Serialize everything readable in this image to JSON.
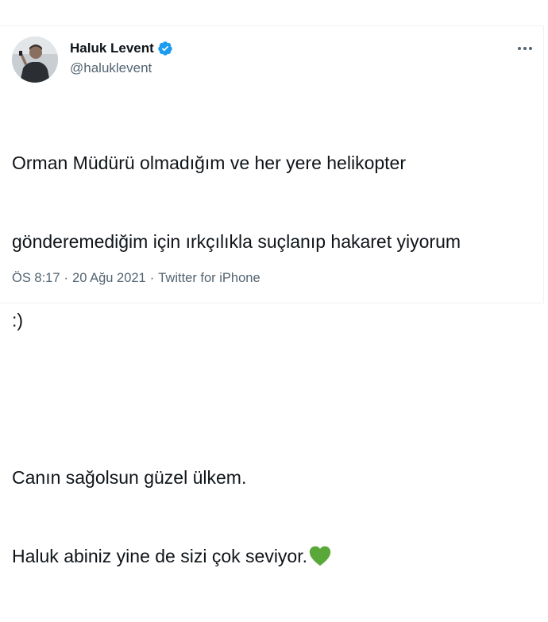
{
  "tweet": {
    "author": {
      "display_name": "Haluk Levent",
      "handle": "@haluklevent",
      "verified_icon": "verified-badge-icon",
      "avatar_icon": "profile-photo"
    },
    "more_icon": "more-options-icon",
    "text_lines": [
      "Orman Müdürü olmadığım ve her yere helikopter",
      "gönderemediğim için ırkçılıkla suçlanıp hakaret yiyorum",
      ":)",
      "",
      "Canın sağolsun güzel ülkem.",
      "Haluk abiniz yine de sizi çok seviyor."
    ],
    "emoji_icon": "green-heart-icon",
    "meta": {
      "time": "ÖS 8:17",
      "separator": "·",
      "date": "20 Ağu 2021",
      "source": "Twitter for iPhone"
    }
  },
  "colors": {
    "text": "#0f1419",
    "secondary": "#536471",
    "verified": "#1d9bf0",
    "heart": "#5aa83a",
    "border": "#eff3f4"
  }
}
